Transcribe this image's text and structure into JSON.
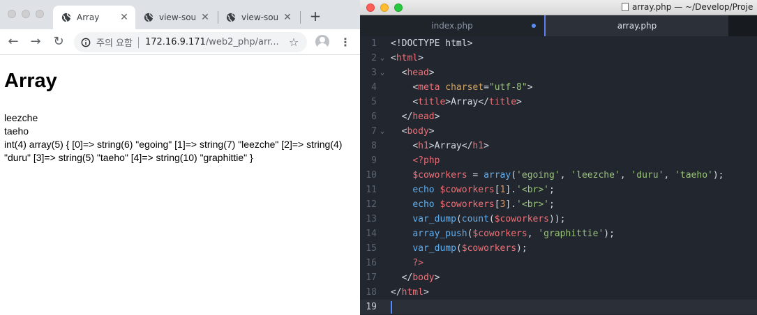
{
  "chrome": {
    "tabs": [
      {
        "title": "Array",
        "active": true
      },
      {
        "title": "view-sou",
        "active": false
      },
      {
        "title": "view-sou",
        "active": false
      }
    ],
    "new_tab_label": "+",
    "nav": {
      "back": "←",
      "forward": "→",
      "reload": "↻"
    },
    "omnibox": {
      "security_label": "주의 요함",
      "url_host": "172.16.9.171",
      "url_path": "/web2_php/arr..."
    },
    "page": {
      "heading": "Array",
      "output_lines": [
        "leezche",
        "taeho",
        "int(4) array(5) { [0]=> string(6) \"egoing\" [1]=> string(7) \"leezche\" [2]=> string(4) \"duru\" [3]=> string(5) \"taeho\" [4]=> string(10) \"graphittie\" }"
      ]
    }
  },
  "editor": {
    "window_title": "array.php — ~/Develop/Proje",
    "tabs": [
      {
        "title": "index.php",
        "active": false,
        "dirty": true
      },
      {
        "title": "array.php",
        "active": true,
        "dirty": false
      }
    ],
    "current_line": 19,
    "lines": [
      {
        "n": "1",
        "fold": false,
        "tokens": [
          [
            "t-punct",
            "<!DOCTYPE html>"
          ]
        ]
      },
      {
        "n": "2",
        "fold": true,
        "tokens": [
          [
            "t-punct",
            "<"
          ],
          [
            "t-tag",
            "html"
          ],
          [
            "t-punct",
            ">"
          ]
        ]
      },
      {
        "n": "3",
        "fold": true,
        "tokens": [
          [
            "t-text",
            "  "
          ],
          [
            "t-punct",
            "<"
          ],
          [
            "t-tag",
            "head"
          ],
          [
            "t-punct",
            ">"
          ]
        ]
      },
      {
        "n": "4",
        "fold": false,
        "tokens": [
          [
            "t-text",
            "    "
          ],
          [
            "t-punct",
            "<"
          ],
          [
            "t-tag",
            "meta "
          ],
          [
            "t-attr",
            "charset"
          ],
          [
            "t-punct",
            "="
          ],
          [
            "t-str",
            "\"utf-8\""
          ],
          [
            "t-punct",
            ">"
          ]
        ]
      },
      {
        "n": "5",
        "fold": false,
        "tokens": [
          [
            "t-text",
            "    "
          ],
          [
            "t-punct",
            "<"
          ],
          [
            "t-tag",
            "title"
          ],
          [
            "t-punct",
            ">"
          ],
          [
            "t-text",
            "Array"
          ],
          [
            "t-punct",
            "</"
          ],
          [
            "t-tag",
            "title"
          ],
          [
            "t-punct",
            ">"
          ]
        ]
      },
      {
        "n": "6",
        "fold": false,
        "tokens": [
          [
            "t-text",
            "  "
          ],
          [
            "t-punct",
            "</"
          ],
          [
            "t-tag",
            "head"
          ],
          [
            "t-punct",
            ">"
          ]
        ]
      },
      {
        "n": "7",
        "fold": true,
        "tokens": [
          [
            "t-text",
            "  "
          ],
          [
            "t-punct",
            "<"
          ],
          [
            "t-tag",
            "body"
          ],
          [
            "t-punct",
            ">"
          ]
        ]
      },
      {
        "n": "8",
        "fold": false,
        "tokens": [
          [
            "t-text",
            "    "
          ],
          [
            "t-punct",
            "<"
          ],
          [
            "t-tag",
            "h1"
          ],
          [
            "t-punct",
            ">"
          ],
          [
            "t-text",
            "Array"
          ],
          [
            "t-punct",
            "</"
          ],
          [
            "t-tag",
            "h1"
          ],
          [
            "t-punct",
            ">"
          ]
        ]
      },
      {
        "n": "9",
        "fold": false,
        "tokens": [
          [
            "t-text",
            "    "
          ],
          [
            "t-php",
            "<?php"
          ]
        ]
      },
      {
        "n": "10",
        "fold": false,
        "tokens": [
          [
            "t-text",
            "    "
          ],
          [
            "t-var",
            "$coworkers"
          ],
          [
            "t-punct",
            " = "
          ],
          [
            "t-fn",
            "array"
          ],
          [
            "t-punct",
            "("
          ],
          [
            "t-str",
            "'egoing'"
          ],
          [
            "t-punct",
            ", "
          ],
          [
            "t-str",
            "'leezche'"
          ],
          [
            "t-punct",
            ", "
          ],
          [
            "t-str",
            "'duru'"
          ],
          [
            "t-punct",
            ", "
          ],
          [
            "t-str",
            "'taeho'"
          ],
          [
            "t-punct",
            ");"
          ]
        ]
      },
      {
        "n": "11",
        "fold": false,
        "tokens": [
          [
            "t-text",
            "    "
          ],
          [
            "t-fn",
            "echo "
          ],
          [
            "t-var",
            "$coworkers"
          ],
          [
            "t-punct",
            "["
          ],
          [
            "t-num",
            "1"
          ],
          [
            "t-punct",
            "]."
          ],
          [
            "t-str",
            "'<br>'"
          ],
          [
            "t-punct",
            ";"
          ]
        ]
      },
      {
        "n": "12",
        "fold": false,
        "tokens": [
          [
            "t-text",
            "    "
          ],
          [
            "t-fn",
            "echo "
          ],
          [
            "t-var",
            "$coworkers"
          ],
          [
            "t-punct",
            "["
          ],
          [
            "t-num",
            "3"
          ],
          [
            "t-punct",
            "]."
          ],
          [
            "t-str",
            "'<br>'"
          ],
          [
            "t-punct",
            ";"
          ]
        ]
      },
      {
        "n": "13",
        "fold": false,
        "tokens": [
          [
            "t-text",
            "    "
          ],
          [
            "t-fn",
            "var_dump"
          ],
          [
            "t-punct",
            "("
          ],
          [
            "t-fn",
            "count"
          ],
          [
            "t-punct",
            "("
          ],
          [
            "t-var",
            "$coworkers"
          ],
          [
            "t-punct",
            "));"
          ]
        ]
      },
      {
        "n": "14",
        "fold": false,
        "tokens": [
          [
            "t-text",
            "    "
          ],
          [
            "t-fn",
            "array_push"
          ],
          [
            "t-punct",
            "("
          ],
          [
            "t-var",
            "$coworkers"
          ],
          [
            "t-punct",
            ", "
          ],
          [
            "t-str",
            "'graphittie'"
          ],
          [
            "t-punct",
            ");"
          ]
        ]
      },
      {
        "n": "15",
        "fold": false,
        "tokens": [
          [
            "t-text",
            "    "
          ],
          [
            "t-fn",
            "var_dump"
          ],
          [
            "t-punct",
            "("
          ],
          [
            "t-var",
            "$coworkers"
          ],
          [
            "t-punct",
            ");"
          ]
        ]
      },
      {
        "n": "16",
        "fold": false,
        "tokens": [
          [
            "t-text",
            "    "
          ],
          [
            "t-php",
            "?>"
          ]
        ]
      },
      {
        "n": "17",
        "fold": false,
        "tokens": [
          [
            "t-text",
            "  "
          ],
          [
            "t-punct",
            "</"
          ],
          [
            "t-tag",
            "body"
          ],
          [
            "t-punct",
            ">"
          ]
        ]
      },
      {
        "n": "18",
        "fold": false,
        "tokens": [
          [
            "t-punct",
            "</"
          ],
          [
            "t-tag",
            "html"
          ],
          [
            "t-punct",
            ">"
          ]
        ]
      },
      {
        "n": "19",
        "fold": false,
        "tokens": []
      }
    ]
  },
  "colors": {
    "editor_bg": "#22262e",
    "chrome_tabstrip": "#dee1e6",
    "mac_close": "#fe5f57",
    "mac_minimize": "#febc2e",
    "mac_zoom": "#28c840",
    "dirty_dot": "#5b8ef0"
  }
}
